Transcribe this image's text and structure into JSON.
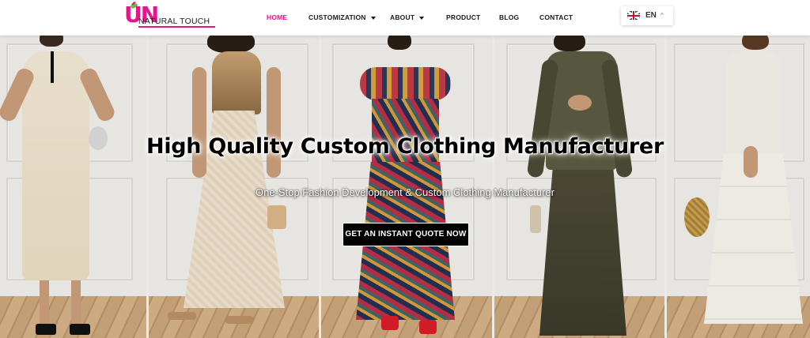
{
  "brand": {
    "logo_mark": "ÚN",
    "logo_text": "NATURAL TOUCH",
    "colors": {
      "primary": "#e3168c",
      "accent": "#58c43a"
    }
  },
  "nav": {
    "items": [
      {
        "label": "HOME",
        "active": true,
        "has_dropdown": false
      },
      {
        "label": "CUSTOMIZATION",
        "active": false,
        "has_dropdown": true
      },
      {
        "label": "ABOUT",
        "active": false,
        "has_dropdown": true
      },
      {
        "label": "PRODUCT",
        "active": false,
        "has_dropdown": false
      },
      {
        "label": "BLOG",
        "active": false,
        "has_dropdown": false
      },
      {
        "label": "CONTACT",
        "active": false,
        "has_dropdown": false
      }
    ]
  },
  "language": {
    "code": "EN",
    "flag_icon": "uk-flag-icon",
    "caret_icon": "chevron-up-icon"
  },
  "hero": {
    "title": "High Quality Custom Clothing Manufacturer",
    "subtitle": "One-Stop Fashion Development & Custom Clothing Manufacturer",
    "cta_label": "GET AN INSTANT QUOTE NOW"
  }
}
